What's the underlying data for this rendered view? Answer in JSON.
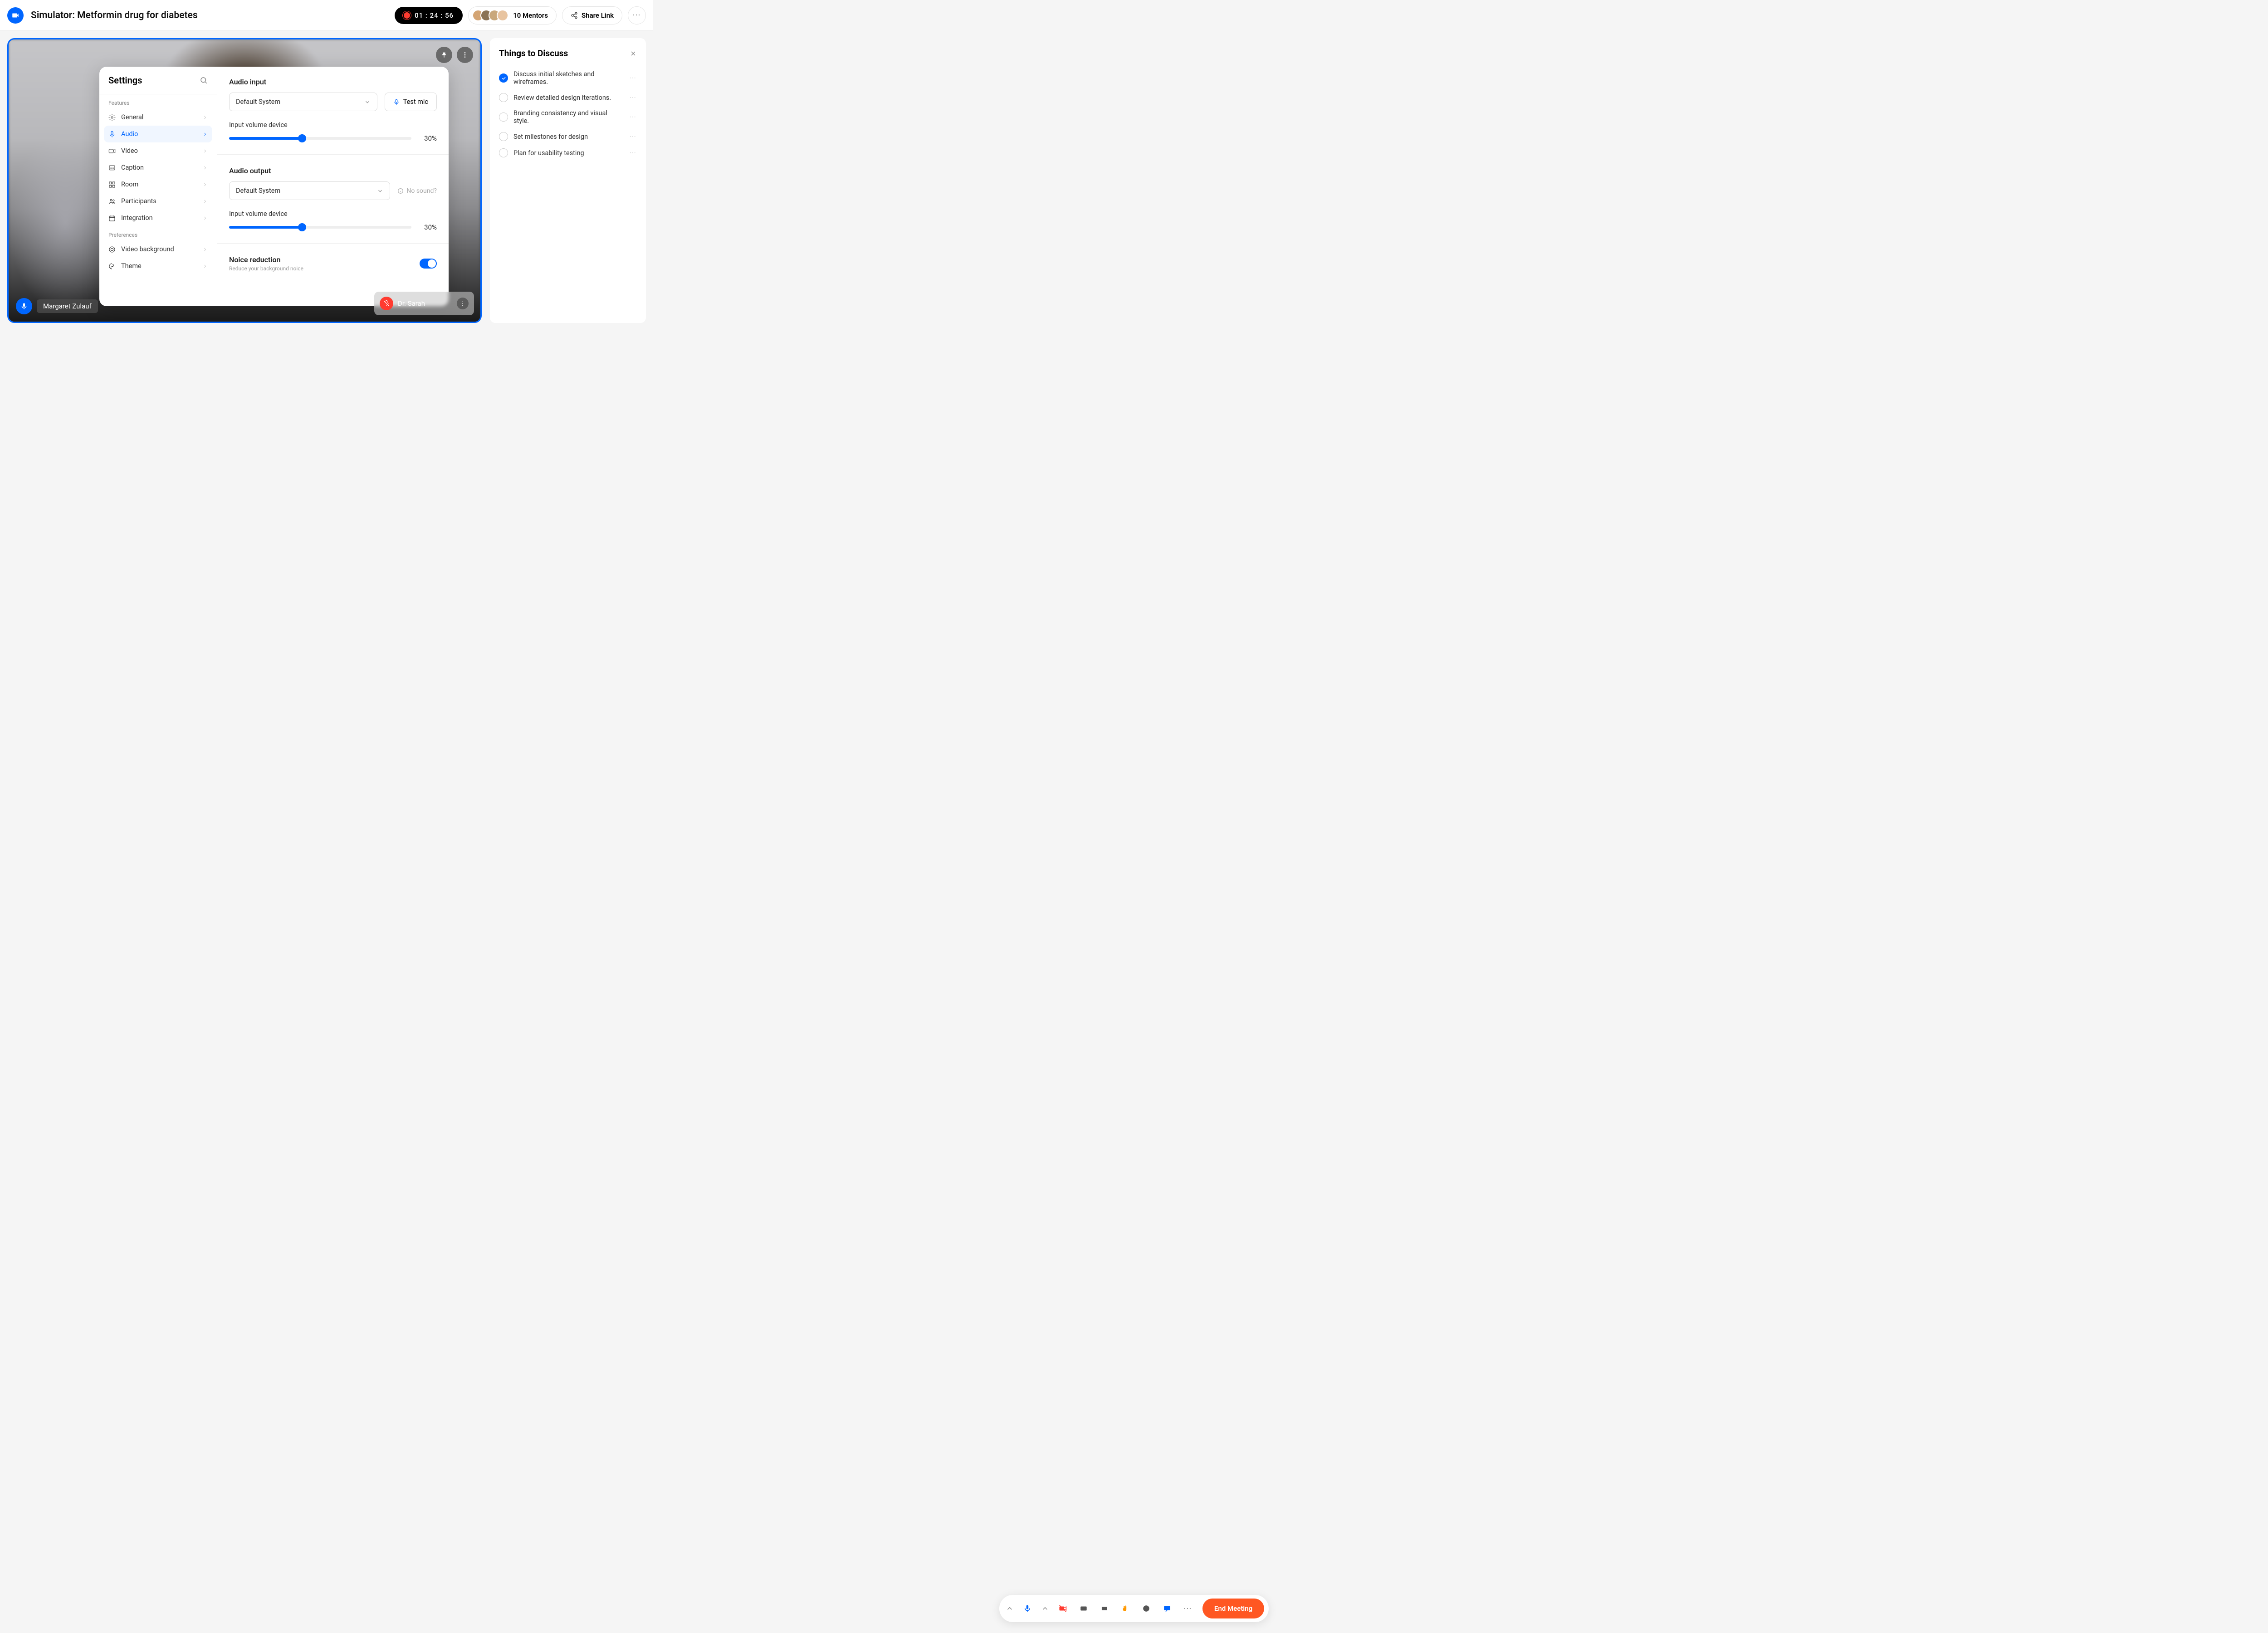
{
  "header": {
    "title": "Simulator: Metformin drug for diabetes",
    "recording_time": "01 : 24 : 56",
    "mentors_label": "10 Mentors",
    "share_label": "Share Link"
  },
  "video": {
    "participant_name": "Margaret Zulauf",
    "pip_name": "Dr. Sarah"
  },
  "settings": {
    "title": "Settings",
    "section_features": "Features",
    "section_prefs": "Preferences",
    "nav": {
      "general": "General",
      "audio": "Audio",
      "video": "Video",
      "caption": "Caption",
      "room": "Room",
      "participants": "Participants",
      "integration": "Integration",
      "video_bg": "Video background",
      "theme": "Theme"
    },
    "audio_input_title": "Audio input",
    "audio_input_value": "Default System",
    "test_mic": "Test mic",
    "input_volume_label": "Input volume device",
    "input_volume_pct": "30%",
    "audio_output_title": "Audio output",
    "audio_output_value": "Default System",
    "no_sound": "No sound?",
    "output_volume_label": "Input volume device",
    "output_volume_pct": "30%",
    "noise_title": "Noice reduction",
    "noise_desc": "Reduce your background noice"
  },
  "discuss": {
    "title": "Things to Discuss",
    "items": [
      {
        "text": "Discuss initial sketches and wireframes.",
        "done": true
      },
      {
        "text": "Review detailed design iterations.",
        "done": false
      },
      {
        "text": "Branding consistency and visual style.",
        "done": false
      },
      {
        "text": "Set milestones for design",
        "done": false
      },
      {
        "text": "Plan for usability testing",
        "done": false
      }
    ]
  },
  "toolbar": {
    "end": "End Meeting"
  },
  "slider": {
    "input_pct": 40,
    "output_pct": 40
  },
  "avatar_colors": [
    "#d4a574",
    "#8b7355",
    "#c9a87c",
    "#e8c4a0"
  ]
}
